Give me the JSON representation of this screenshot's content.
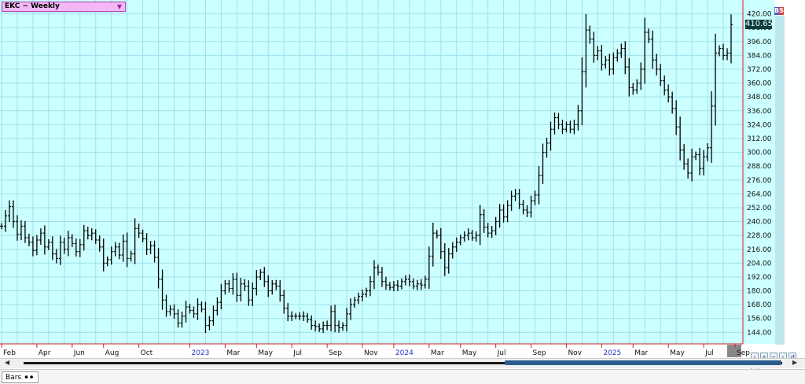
{
  "symbol_label": "EKC ~ Weekly",
  "last_price_label": "410.65",
  "status": {
    "tab_label": "Bars"
  },
  "colors": {
    "plot_bg": "#ccffff",
    "grid": "#9fe0ec",
    "bars": "#000000",
    "time_axis_line": "#d02020",
    "year_label": "#2233cc"
  },
  "chart_data": {
    "type": "ohlc",
    "ylim": [
      134,
      432
    ],
    "y_ticks": [
      144,
      156,
      168,
      180,
      192,
      204,
      216,
      228,
      240,
      252,
      264,
      276,
      288,
      300,
      312,
      324,
      336,
      348,
      360,
      372,
      384,
      396,
      408,
      420
    ],
    "y_tick_labels": [
      "144.00",
      "156.00",
      "168.00",
      "180.00",
      "192.00",
      "204.00",
      "216.00",
      "228.00",
      "240.00",
      "252.00",
      "264.00",
      "276.00",
      "288.00",
      "300.00",
      "312.00",
      "324.00",
      "336.00",
      "348.00",
      "360.00",
      "372.00",
      "384.00",
      "396.00",
      "408.00",
      "420.00"
    ],
    "x_labels": [
      {
        "label": "Feb",
        "week": 0
      },
      {
        "label": "Apr",
        "week": 9
      },
      {
        "label": "Jun",
        "week": 18
      },
      {
        "label": "Aug",
        "week": 26
      },
      {
        "label": "Oct",
        "week": 35
      },
      {
        "label": "2023",
        "week": 48,
        "year": true
      },
      {
        "label": "Mar",
        "week": 57
      },
      {
        "label": "May",
        "week": 65
      },
      {
        "label": "Jul",
        "week": 74
      },
      {
        "label": "Sep",
        "week": 83
      },
      {
        "label": "Nov",
        "week": 92
      },
      {
        "label": "2024",
        "week": 100,
        "year": true
      },
      {
        "label": "Mar",
        "week": 109
      },
      {
        "label": "May",
        "week": 117
      },
      {
        "label": "Jul",
        "week": 126
      },
      {
        "label": "Sep",
        "week": 135
      },
      {
        "label": "Nov",
        "week": 144
      },
      {
        "label": "2025",
        "week": 153,
        "year": true
      },
      {
        "label": "Mar",
        "week": 161
      },
      {
        "label": "May",
        "week": 170
      },
      {
        "label": "Jul",
        "week": 179
      },
      {
        "label": "Sep",
        "week": 187
      }
    ],
    "weekly_close": [
      236,
      245,
      253,
      240,
      229,
      236,
      226,
      222,
      215,
      224,
      230,
      218,
      222,
      212,
      208,
      222,
      216,
      226,
      221,
      214,
      220,
      232,
      228,
      230,
      224,
      218,
      204,
      207,
      214,
      218,
      211,
      223,
      208,
      212,
      234,
      230,
      225,
      216,
      219,
      209,
      190,
      172,
      162,
      164,
      160,
      152,
      158,
      166,
      163,
      160,
      168,
      164,
      150,
      154,
      163,
      170,
      180,
      186,
      182,
      190,
      176,
      186,
      184,
      172,
      182,
      192,
      196,
      188,
      180,
      186,
      184,
      176,
      165,
      158,
      158,
      158,
      158,
      158,
      155,
      150,
      149,
      147,
      150,
      150,
      162,
      150,
      148,
      150,
      160,
      168,
      172,
      175,
      177,
      180,
      188,
      200,
      196,
      188,
      185,
      183,
      185,
      184,
      188,
      190,
      188,
      184,
      186,
      185,
      190,
      210,
      230,
      228,
      214,
      200,
      212,
      218,
      222,
      226,
      228,
      230,
      226,
      228,
      246,
      235,
      230,
      232,
      240,
      250,
      244,
      254,
      262,
      264,
      255,
      250,
      248,
      258,
      263,
      280,
      300,
      308,
      320,
      330,
      324,
      320,
      324,
      320,
      324,
      336,
      370,
      406,
      398,
      384,
      388,
      376,
      380,
      372,
      382,
      386,
      390,
      374,
      356,
      354,
      360,
      372,
      404,
      398,
      380,
      372,
      362,
      354,
      348,
      338,
      322,
      302,
      290,
      282,
      296,
      298,
      286,
      296,
      304,
      340,
      386,
      390,
      384,
      386,
      410.65
    ]
  }
}
